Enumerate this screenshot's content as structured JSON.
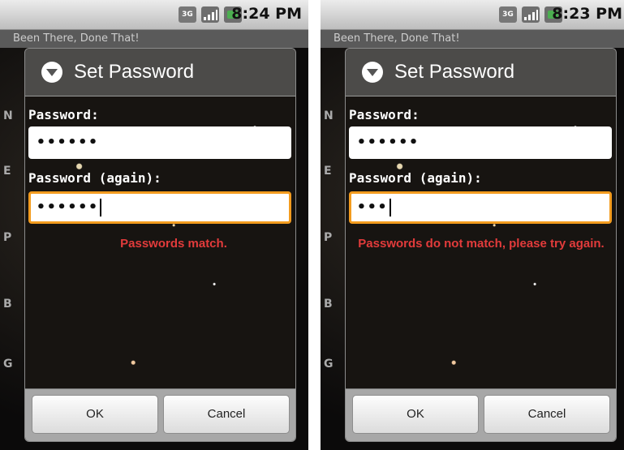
{
  "left": {
    "status": {
      "net": "3G",
      "time": "8:24 PM"
    },
    "app_title": "Been There, Done That!",
    "bg_labels": [
      "N",
      "E",
      "P",
      "B",
      "G"
    ],
    "dialog": {
      "title": "Set Password",
      "password_label": "Password:",
      "password_value": "••••••",
      "password_again_label": "Password (again):",
      "password_again_value": "••••••",
      "message": "Passwords match.",
      "ok_label": "OK",
      "cancel_label": "Cancel"
    }
  },
  "right": {
    "status": {
      "net": "3G",
      "time": "8:23 PM"
    },
    "app_title": "Been There, Done That!",
    "bg_labels": [
      "N",
      "E",
      "P",
      "B",
      "G"
    ],
    "dialog": {
      "title": "Set Password",
      "password_label": "Password:",
      "password_value": "••••••",
      "password_again_label": "Password (again):",
      "password_again_value": "•••",
      "message": "Passwords do not match, please try again.",
      "ok_label": "OK",
      "cancel_label": "Cancel"
    }
  },
  "colors": {
    "accent_focus": "#f39c1f",
    "message_red": "#e23b3b"
  }
}
